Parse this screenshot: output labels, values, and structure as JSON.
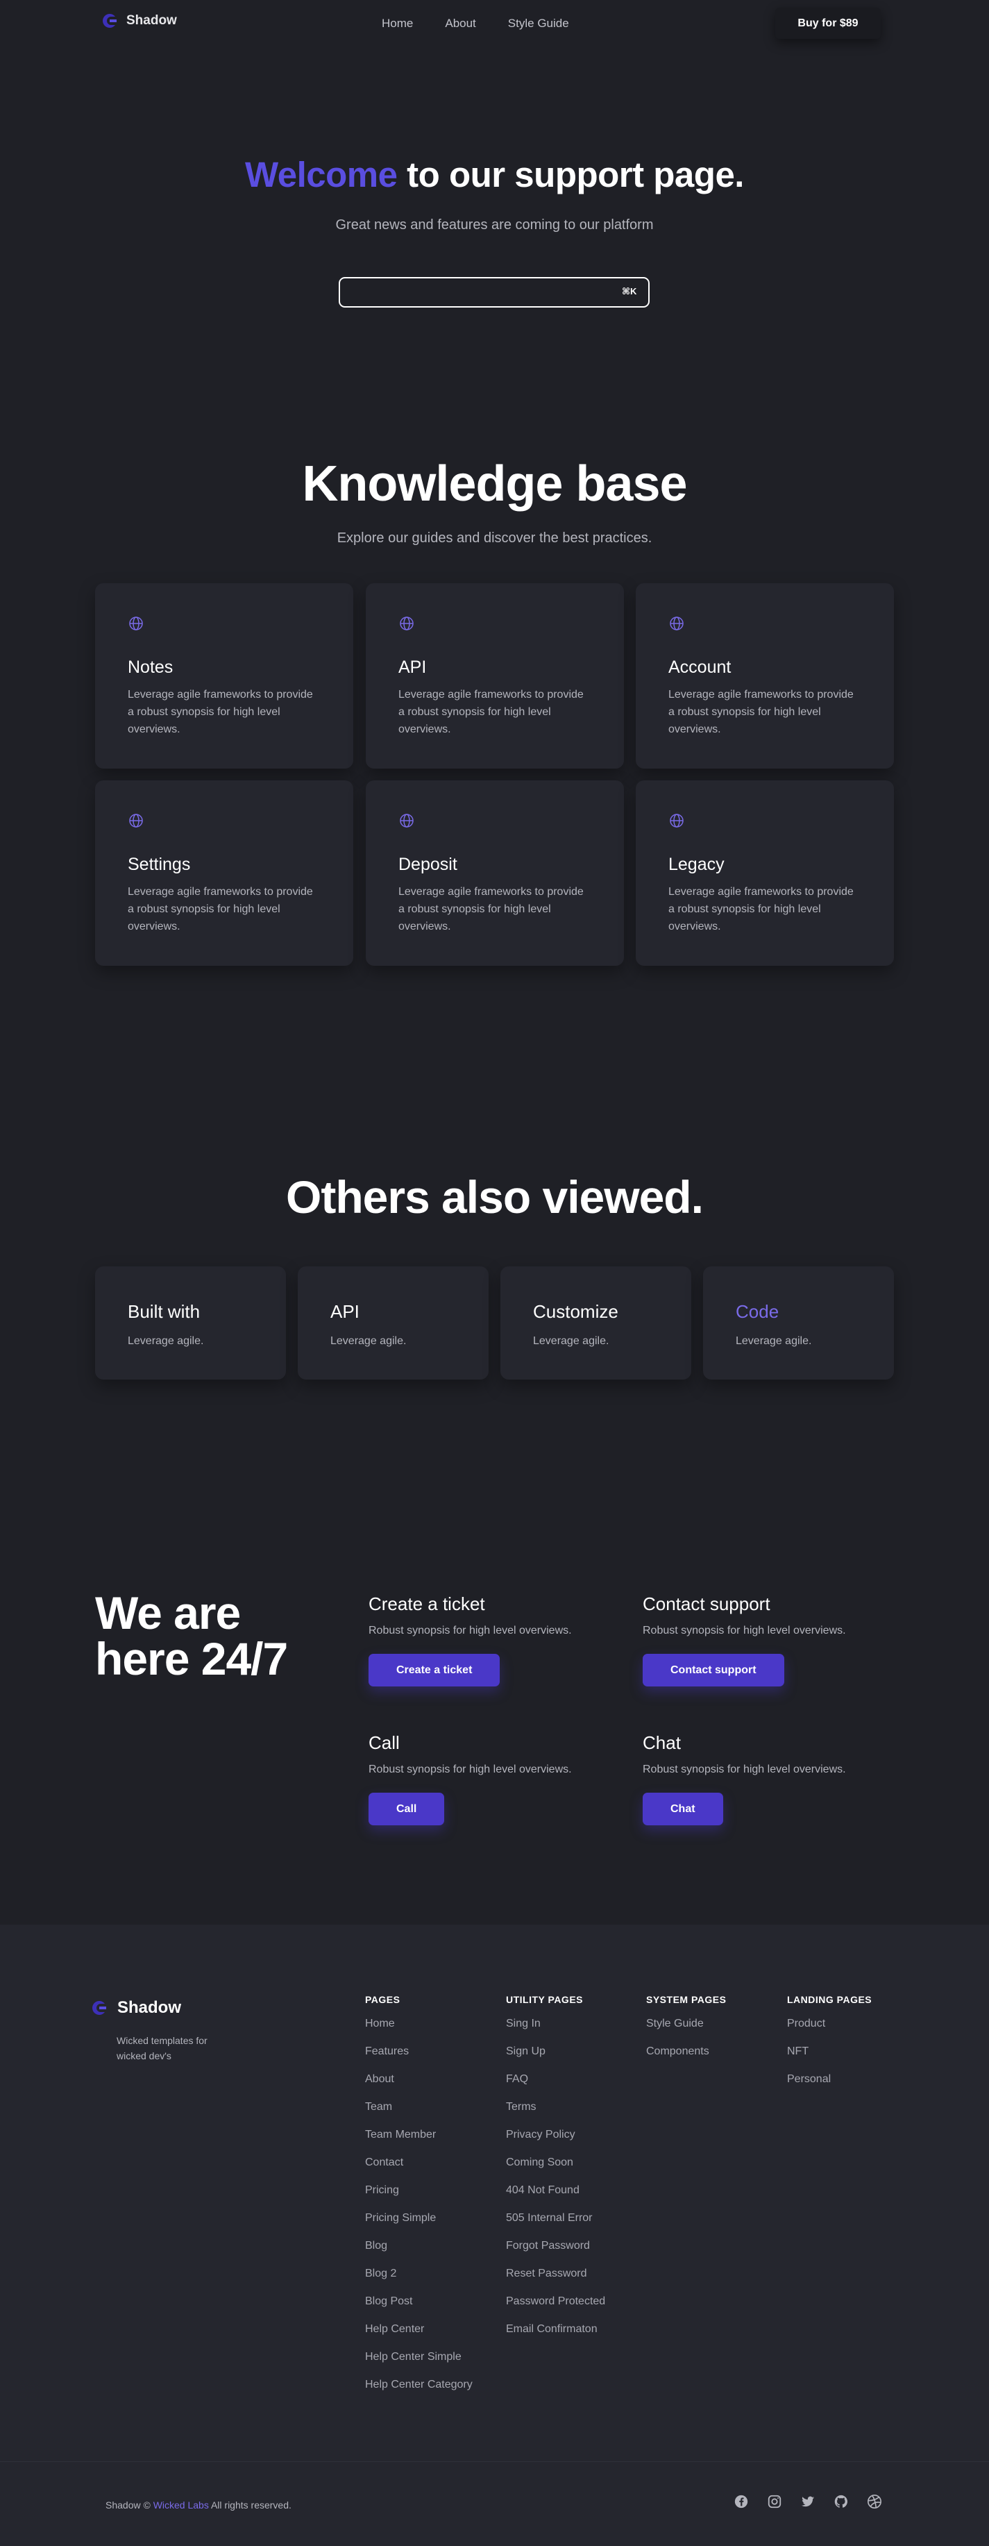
{
  "nav": {
    "brand": "Shadow",
    "links": [
      "Home",
      "About",
      "Style Guide"
    ],
    "buy_label": "Buy for $89"
  },
  "hero": {
    "title_accent": "Welcome",
    "title_rest": " to our support page.",
    "subtitle": "Great news and features are coming to our platform",
    "search_placeholder": "",
    "search_shortcut": "⌘K"
  },
  "knowledge_base": {
    "title": "Knowledge base",
    "subtitle": "Explore our guides and discover the best practices.",
    "cards": [
      {
        "title": "Notes",
        "text": "Leverage agile frameworks to provide a robust synopsis for high level overviews."
      },
      {
        "title": "API",
        "text": "Leverage agile frameworks to provide a robust synopsis for high level overviews."
      },
      {
        "title": "Account",
        "text": "Leverage agile frameworks to provide a robust synopsis for high level overviews."
      },
      {
        "title": "Settings",
        "text": "Leverage agile frameworks to provide a robust synopsis for high level overviews."
      },
      {
        "title": "Deposit",
        "text": "Leverage agile frameworks to provide a robust synopsis for high level overviews."
      },
      {
        "title": "Legacy",
        "text": "Leverage agile frameworks to provide a robust synopsis for high level overviews."
      }
    ]
  },
  "others": {
    "title": "Others also viewed.",
    "cards": [
      {
        "title": "Built with",
        "text": "Leverage agile."
      },
      {
        "title": "API",
        "text": "Leverage agile."
      },
      {
        "title": "Customize",
        "text": "Leverage agile."
      },
      {
        "title": "Code",
        "text": "Leverage agile."
      }
    ]
  },
  "support": {
    "title": "We are here 24/7",
    "items": [
      {
        "title": "Create a ticket",
        "text": "Robust synopsis for high level overviews.",
        "button": "Create a ticket"
      },
      {
        "title": "Contact support",
        "text": "Robust synopsis for high level overviews.",
        "button": "Contact support"
      },
      {
        "title": "Call",
        "text": "Robust synopsis for high level overviews.",
        "button": "Call"
      },
      {
        "title": "Chat",
        "text": "Robust synopsis for high level overviews.",
        "button": "Chat"
      }
    ]
  },
  "footer": {
    "brand": "Shadow",
    "tagline": "Wicked templates for wicked dev's",
    "columns": [
      {
        "heading": "PAGES",
        "links": [
          "Home",
          "Features",
          "About",
          "Team",
          "Team Member",
          "Contact",
          "Pricing",
          "Pricing Simple",
          "Blog",
          "Blog 2",
          "Blog Post",
          "Help Center",
          "Help Center Simple",
          "Help Center Category"
        ]
      },
      {
        "heading": "UTILITY PAGES",
        "links": [
          "Sing In",
          "Sign Up",
          "FAQ",
          "Terms",
          "Privacy Policy",
          "Coming Soon",
          "404 Not Found",
          "505 Internal Error",
          "Forgot Password",
          "Reset Password",
          "Password Protected",
          "Email Confirmaton"
        ]
      },
      {
        "heading": "SYSTEM PAGES",
        "links": [
          "Style Guide",
          "Components"
        ]
      },
      {
        "heading": "LANDING PAGES",
        "links": [
          "Product",
          "NFT",
          "Personal"
        ]
      }
    ],
    "copyright_prefix": "Shadow © ",
    "copyright_link": "Wicked Labs",
    "copyright_suffix": " All rights reserved.",
    "socials": [
      "facebook-icon",
      "instagram-icon",
      "twitter-icon",
      "github-icon",
      "dribbble-icon"
    ]
  },
  "colors": {
    "background": "#1f2026",
    "card": "#25262e",
    "accent": "#5a4ee0",
    "button": "#4a38c8",
    "muted_text": "#b4b5bd"
  }
}
